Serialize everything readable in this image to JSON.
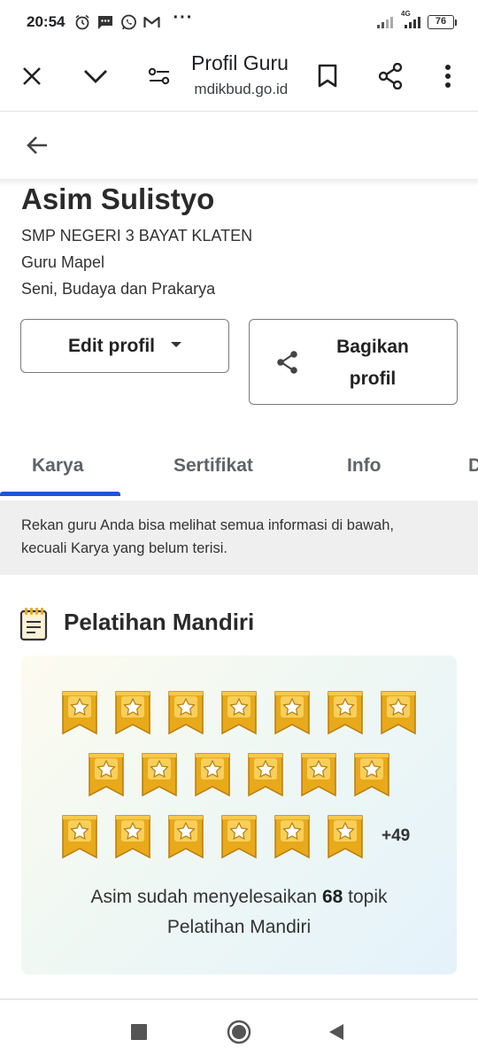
{
  "status_bar": {
    "time": "20:54",
    "network": "4G",
    "battery": "76",
    "icons": [
      "alarm-icon",
      "message-icon",
      "whatsapp-icon",
      "gmail-icon",
      "more-dots-icon",
      "signal-icon",
      "signal-4g-icon",
      "battery-icon"
    ]
  },
  "browser": {
    "title": "Profil Guru",
    "url": " mdikbud.go.id",
    "icons": [
      "close-icon",
      "chevron-down-icon",
      "page-settings-icon",
      "bookmark-icon",
      "share-icon",
      "more-vert-icon"
    ]
  },
  "profile": {
    "name": "Asim Sulistyo",
    "school": "SMP NEGERI 3 BAYAT KLATEN",
    "role": "Guru Mapel",
    "subject": "Seni, Budaya dan Prakarya",
    "edit_label": "Edit profil",
    "share_label_1": "Bagikan",
    "share_label_2": "profil"
  },
  "tabs": {
    "items": [
      "Karya",
      "Sertifikat",
      "Info",
      "D"
    ],
    "active": "Karya"
  },
  "info_text_1": "Rekan guru Anda bisa melihat semua informasi di bawah,",
  "info_text_2": "kecuali Karya yang belum terisi.",
  "section": {
    "title": "Pelatihan Mandiri",
    "more_count": "+49",
    "badges_shown": 19,
    "summary_pre": "Asim sudah menyelesaikan ",
    "summary_count": "68",
    "summary_post": " topik",
    "summary_line2": "Pelatihan Mandiri"
  },
  "colors": {
    "accent": "#1a56db",
    "badge_gold": "#e8a91a"
  }
}
